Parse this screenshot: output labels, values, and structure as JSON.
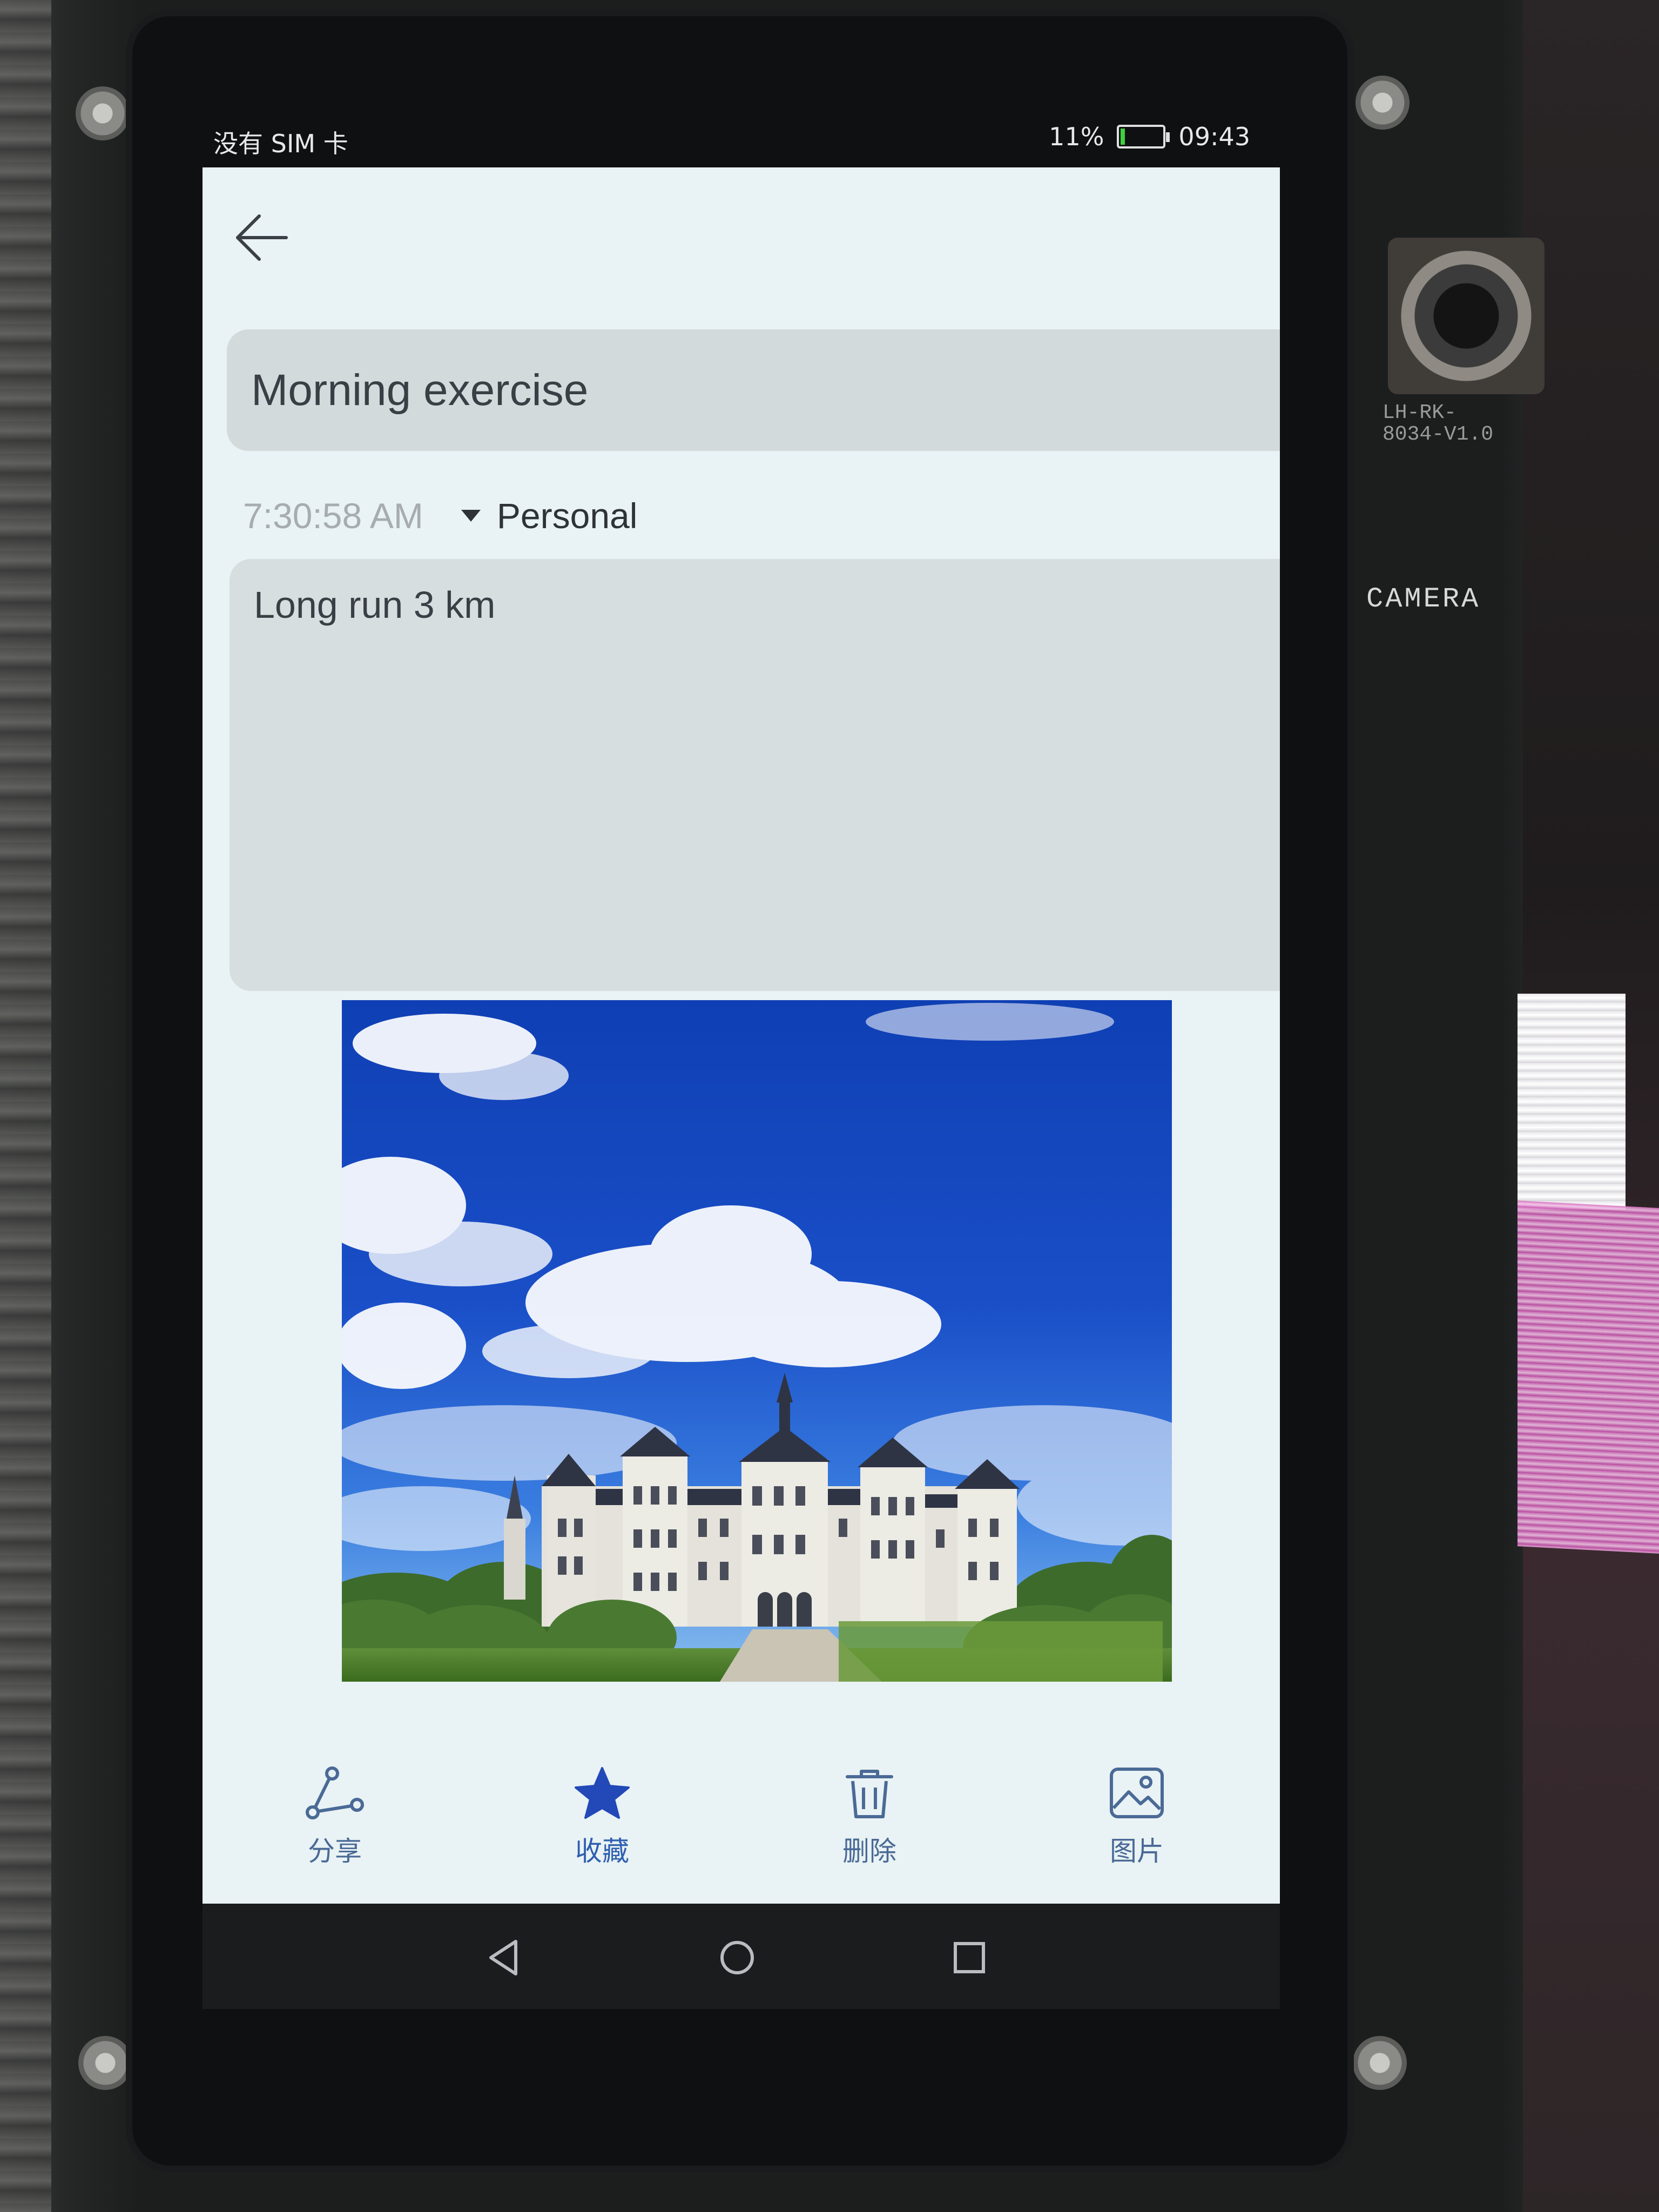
{
  "status_bar": {
    "carrier": "没有 SIM 卡",
    "battery_percent_text": "11%",
    "battery_level": 0.11,
    "time": "09:43"
  },
  "note": {
    "title": "Morning exercise",
    "time": "7:30:58 AM",
    "category": "Personal",
    "content": "Long run 3 km"
  },
  "toolbar": {
    "share_label": "分享",
    "favorite_label": "收藏",
    "delete_label": "删除",
    "image_label": "图片"
  },
  "board": {
    "camera_label": "CAMERA",
    "module_label": "LH-RK-8034-V1.0"
  },
  "colors": {
    "screen_bg": "#e9f2f4",
    "field_bg": "#d3dadc",
    "accent": "#2f5fb0",
    "toolbar_text": "#4a6a96"
  }
}
